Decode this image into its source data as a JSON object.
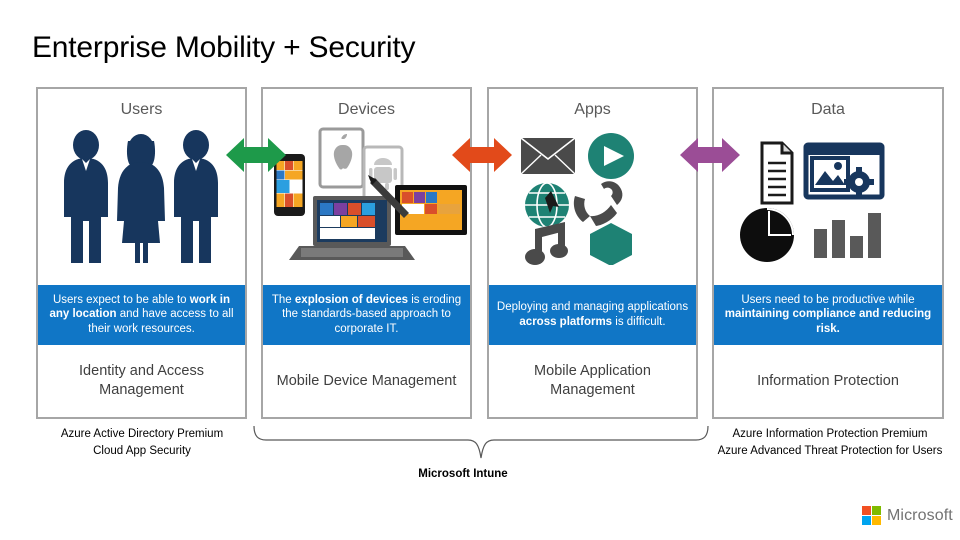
{
  "slide": {
    "title": "Enterprise Mobility + Security"
  },
  "colors": {
    "band_blue": "#1076C6",
    "card_border": "#A6A6A6",
    "arrow_green": "#1E9A4A",
    "arrow_orange": "#E24A1A",
    "arrow_purple": "#9B4D96",
    "navy": "#17365D",
    "teal": "#1E8274",
    "dark_gray": "#404040",
    "header_gray": "#595959"
  },
  "columns": [
    {
      "header": "Users",
      "art_icon": "three-people-icon",
      "statement_plain_1": "Users expect to be able to ",
      "statement_bold": "work in any location",
      "statement_plain_2": " and have access to all their work resources.",
      "capability": "Identity and Access Management"
    },
    {
      "header": "Devices",
      "art_icon": "multi-device-icon",
      "statement_plain_1": "The ",
      "statement_bold": "explosion of devices",
      "statement_plain_2": " is eroding the standards-based approach to corporate IT.",
      "capability": "Mobile Device Management"
    },
    {
      "header": "Apps",
      "art_icon": "app-icons-grid",
      "statement_plain_1": "Deploying and managing applications ",
      "statement_bold": "across platforms",
      "statement_plain_2": " is difficult.",
      "capability": "Mobile Application Management"
    },
    {
      "header": "Data",
      "art_icon": "data-documents-charts-icon",
      "statement_plain_1": "Users need to be productive while ",
      "statement_bold": "maintaining compliance and reducing risk.",
      "statement_plain_2": "",
      "capability": "Information Protection"
    }
  ],
  "arrows": [
    {
      "name": "double-arrow-green",
      "color": "#1E9A4A"
    },
    {
      "name": "double-arrow-orange",
      "color": "#E24A1A"
    },
    {
      "name": "double-arrow-purple",
      "color": "#9B4D96"
    }
  ],
  "footnotes": {
    "left": "Azure Active Directory Premium\nCloud App Security",
    "middle": "Microsoft Intune",
    "right": "Azure Information Protection Premium\nAzure Advanced Threat Protection for Users"
  },
  "branding": {
    "name": "Microsoft",
    "logo_colors": [
      "#F25022",
      "#7FBA00",
      "#00A4EF",
      "#FFB900"
    ]
  }
}
